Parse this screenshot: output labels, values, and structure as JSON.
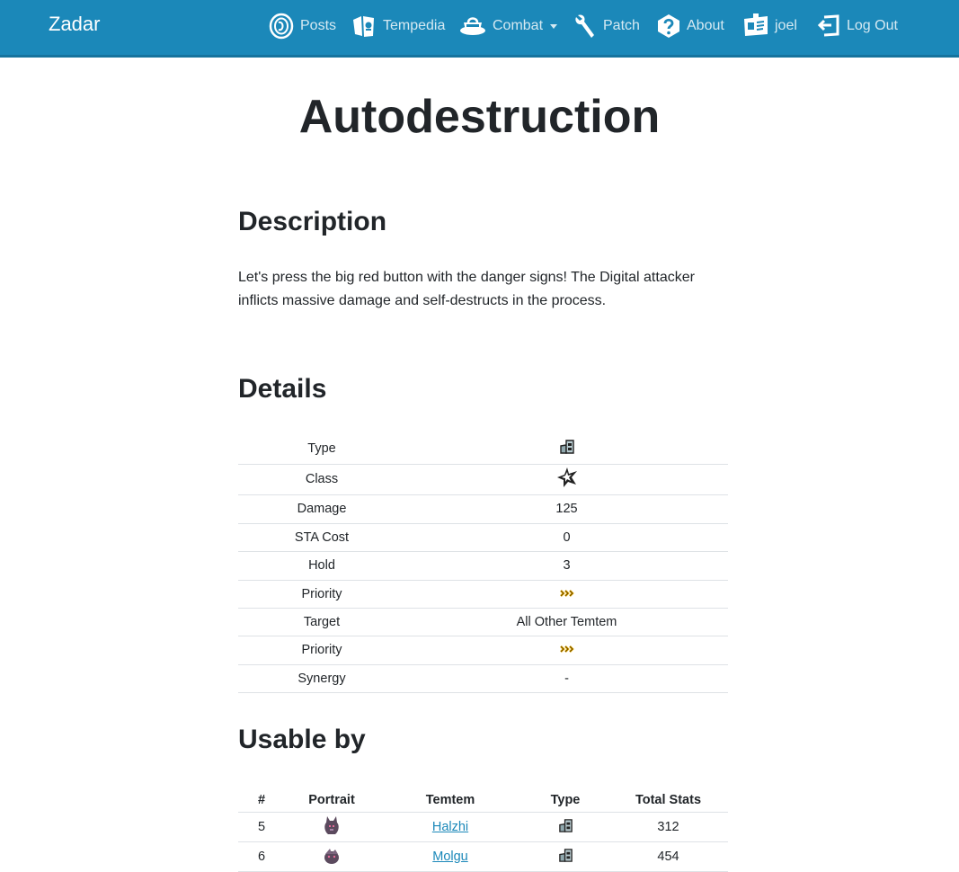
{
  "navbar": {
    "brand": "Zadar",
    "items": [
      {
        "label": "Posts",
        "icon": "posts-icon"
      },
      {
        "label": "Tempedia",
        "icon": "tempedia-icon"
      },
      {
        "label": "Combat",
        "icon": "combat-icon",
        "has_dropdown": true
      },
      {
        "label": "Patch",
        "icon": "wrench-icon"
      },
      {
        "label": "About",
        "icon": "question-icon"
      },
      {
        "label": "joel",
        "icon": "id-card-icon"
      },
      {
        "label": "Log Out",
        "icon": "logout-icon"
      }
    ],
    "colors": {
      "background": "#1b88b9"
    }
  },
  "page": {
    "title": "Autodestruction",
    "description_heading": "Description",
    "description": "Let's press the big red button with the danger signs! The Digital attacker inflicts massive damage and self-destructs in the process.",
    "details_heading": "Details",
    "details": [
      {
        "label": "Type",
        "value": "",
        "icon": "digital-type-icon"
      },
      {
        "label": "Class",
        "value": "",
        "icon": "physical-class-icon"
      },
      {
        "label": "Damage",
        "value": "125"
      },
      {
        "label": "STA Cost",
        "value": "0"
      },
      {
        "label": "Hold",
        "value": "3"
      },
      {
        "label": "Priority",
        "value": "",
        "icon": "priority-icon"
      },
      {
        "label": "Target",
        "value": "All Other Temtem"
      },
      {
        "label": "Priority",
        "value": "",
        "icon": "priority-icon"
      },
      {
        "label": "Synergy",
        "value": "-"
      }
    ],
    "usable_heading": "Usable by",
    "usable_columns": [
      "#",
      "Portrait",
      "Temtem",
      "Type",
      "Total Stats"
    ],
    "usable_rows": [
      {
        "num": "5",
        "portrait": "halzhi-portrait",
        "name": "Halzhi",
        "type_icon": "digital-type-icon",
        "total": "312"
      },
      {
        "num": "6",
        "portrait": "molgu-portrait",
        "name": "Molgu",
        "type_icon": "digital-type-icon",
        "total": "454"
      }
    ]
  }
}
